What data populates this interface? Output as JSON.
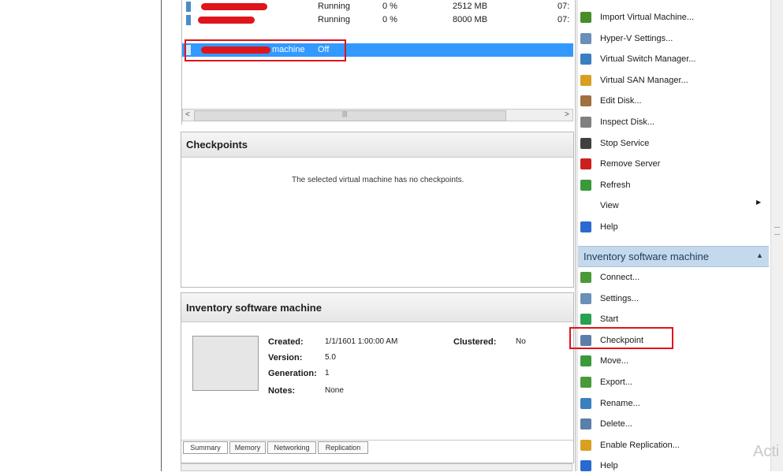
{
  "vm_list": {
    "rows": [
      {
        "name": "",
        "state": "Running",
        "cpu": "0 %",
        "memory": "2512 MB",
        "uptime": "07:"
      },
      {
        "name": "",
        "state": "Running",
        "cpu": "0 %",
        "memory": "8000 MB",
        "uptime": "07:"
      },
      {
        "name": "machine",
        "state": "Off",
        "cpu": "",
        "memory": "",
        "uptime": ""
      }
    ],
    "scroll_left": "<",
    "scroll_grip": "|||",
    "scroll_right": ">"
  },
  "checkpoints": {
    "title": "Checkpoints",
    "empty_message": "The selected virtual machine has no checkpoints."
  },
  "details": {
    "title": "Inventory software machine",
    "created_label": "Created:",
    "created_value": "1/1/1601 1:00:00 AM",
    "clustered_label": "Clustered:",
    "clustered_value": "No",
    "version_label": "Version:",
    "version_value": "5.0",
    "generation_label": "Generation:",
    "generation_value": "1",
    "notes_label": "Notes:",
    "notes_value": "None",
    "tabs": [
      "Summary",
      "Memory",
      "Networking",
      "Replication"
    ]
  },
  "actions": {
    "server_items": [
      {
        "label": "Import Virtual Machine...",
        "icon": "import-vm-icon",
        "color": "#4a8c2a"
      },
      {
        "label": "Hyper-V Settings...",
        "icon": "settings-icon",
        "color": "#6a8fb8"
      },
      {
        "label": "Virtual Switch Manager...",
        "icon": "switch-icon",
        "color": "#3a7fc0"
      },
      {
        "label": "Virtual SAN Manager...",
        "icon": "san-icon",
        "color": "#d8a020"
      },
      {
        "label": "Edit Disk...",
        "icon": "edit-disk-icon",
        "color": "#a07040"
      },
      {
        "label": "Inspect Disk...",
        "icon": "inspect-disk-icon",
        "color": "#808080"
      },
      {
        "label": "Stop Service",
        "icon": "stop-icon",
        "color": "#404040"
      },
      {
        "label": "Remove Server",
        "icon": "remove-icon",
        "color": "#cc2020"
      },
      {
        "label": "Refresh",
        "icon": "refresh-icon",
        "color": "#3a9a3a"
      },
      {
        "label": "View",
        "icon": "",
        "color": "#ffffff"
      },
      {
        "label": "Help",
        "icon": "help-icon",
        "color": "#2a6ad0"
      }
    ],
    "view_arrow": "▶",
    "vm_section_title": "Inventory software machine",
    "vm_section_arrow": "▲",
    "vm_items": [
      {
        "label": "Connect...",
        "icon": "connect-icon",
        "color": "#4a9a3a"
      },
      {
        "label": "Settings...",
        "icon": "settings-icon",
        "color": "#6a8fb8"
      },
      {
        "label": "Start",
        "icon": "start-icon",
        "color": "#2aa050"
      },
      {
        "label": "Checkpoint",
        "icon": "checkpoint-icon",
        "color": "#5a7fa8"
      },
      {
        "label": "Move...",
        "icon": "move-icon",
        "color": "#3a9a3a"
      },
      {
        "label": "Export...",
        "icon": "export-icon",
        "color": "#4a9a3a"
      },
      {
        "label": "Rename...",
        "icon": "rename-icon",
        "color": "#3a7fc0"
      },
      {
        "label": "Delete...",
        "icon": "delete-icon",
        "color": "#5a7fa8"
      },
      {
        "label": "Enable Replication...",
        "icon": "replication-icon",
        "color": "#d8a020"
      },
      {
        "label": "Help",
        "icon": "help-icon",
        "color": "#2a6ad0"
      }
    ]
  },
  "watermark": "Acti",
  "colors": {
    "selection": "#3399ff",
    "highlight_box": "#e0141b",
    "section_header": "#c5d9ec"
  }
}
